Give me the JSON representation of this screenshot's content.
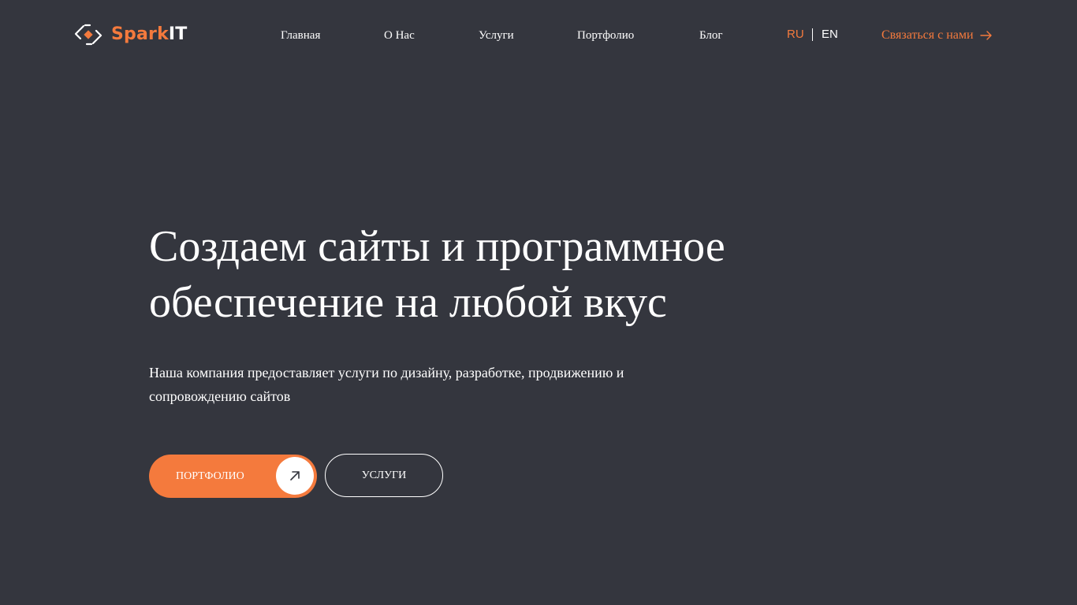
{
  "brand": {
    "name_part1": "Spark",
    "name_part2": "IT",
    "accent_color": "#f47a3d",
    "background_color": "#34363e",
    "logo_icon": "spark-logo-icon"
  },
  "nav": {
    "items": [
      {
        "label": "Главная"
      },
      {
        "label": "О Нас"
      },
      {
        "label": "Услуги"
      },
      {
        "label": "Портфолио"
      },
      {
        "label": "Блог"
      }
    ]
  },
  "lang": {
    "ru": "RU",
    "en": "EN",
    "active": "RU"
  },
  "contact": {
    "label": "Связаться с нами",
    "icon": "arrow-right-icon"
  },
  "hero": {
    "title_line1": "Создаем сайты и программное",
    "title_line2": "обеспечение на любой вкус",
    "subtitle_line1": "Наша компания предоставляет услуги по дизайну, разработке, продвижению и",
    "subtitle_line2": "сопровождению сайтов",
    "primary_button": {
      "label": "Портфолио",
      "icon": "arrow-up-right-icon"
    },
    "secondary_button": {
      "label": "Услуги"
    }
  }
}
